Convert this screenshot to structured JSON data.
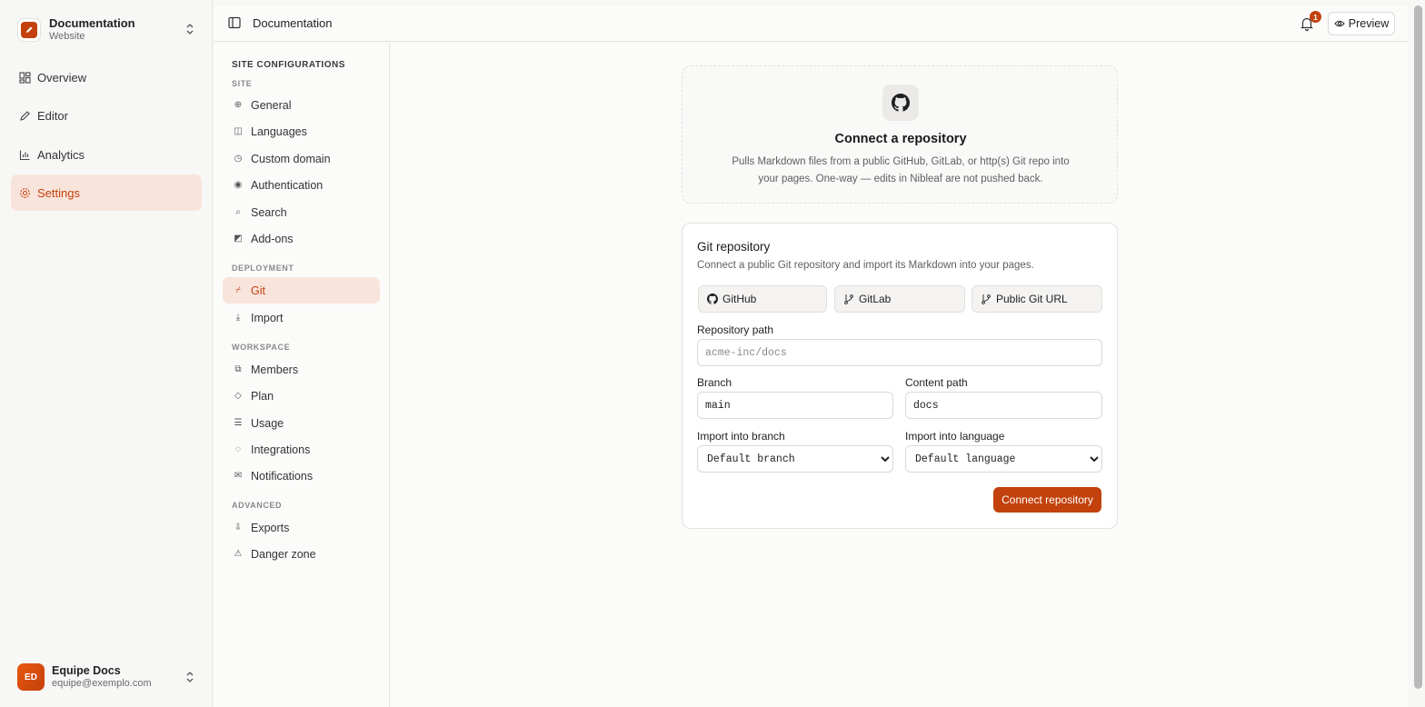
{
  "workspace": {
    "name": "Documentation",
    "subtitle": "Website"
  },
  "nav": {
    "items": [
      {
        "label": "Overview",
        "icon": "grid-icon"
      },
      {
        "label": "Editor",
        "icon": "pen-icon"
      },
      {
        "label": "Analytics",
        "icon": "chart-icon"
      },
      {
        "label": "Settings",
        "icon": "gear-icon",
        "active": true
      }
    ]
  },
  "user": {
    "initials": "ED",
    "name": "Equipe Docs",
    "email": "equipe@exemplo.com"
  },
  "topbar": {
    "title": "Documentation",
    "notification_count": "1",
    "preview_label": "Preview"
  },
  "settings_nav": {
    "title": "SITE CONFIGURATIONS",
    "groups": [
      {
        "title": "SITE",
        "items": [
          "General",
          "Languages",
          "Custom domain",
          "Authentication",
          "Search",
          "Add-ons"
        ]
      },
      {
        "title": "DEPLOYMENT",
        "items": [
          "Git",
          "Import"
        ]
      },
      {
        "title": "WORKSPACE",
        "items": [
          "Members",
          "Plan",
          "Usage",
          "Integrations",
          "Notifications"
        ]
      },
      {
        "title": "ADVANCED",
        "items": [
          "Exports",
          "Danger zone"
        ]
      }
    ],
    "active_item": "Git"
  },
  "hero": {
    "title": "Connect a repository",
    "description": "Pulls Markdown files from a public GitHub, GitLab, or http(s) Git repo into your pages. One-way — edits in Nibleaf are not pushed back."
  },
  "git_card": {
    "title": "Git repository",
    "description": "Connect a public Git repository and import its Markdown into your pages.",
    "providers": [
      "GitHub",
      "GitLab",
      "Public Git URL"
    ],
    "repo_path": {
      "label": "Repository path",
      "placeholder": "acme-inc/docs",
      "value": ""
    },
    "branch": {
      "label": "Branch",
      "value": "main"
    },
    "content_path": {
      "label": "Content path",
      "value": "docs"
    },
    "import_branch": {
      "label": "Import into branch",
      "selected": "Default branch"
    },
    "import_language": {
      "label": "Import into language",
      "selected": "Default language"
    },
    "connect_label": "Connect repository"
  },
  "colors": {
    "accent": "#c2410c",
    "accent_soft": "#f9e4dc"
  }
}
